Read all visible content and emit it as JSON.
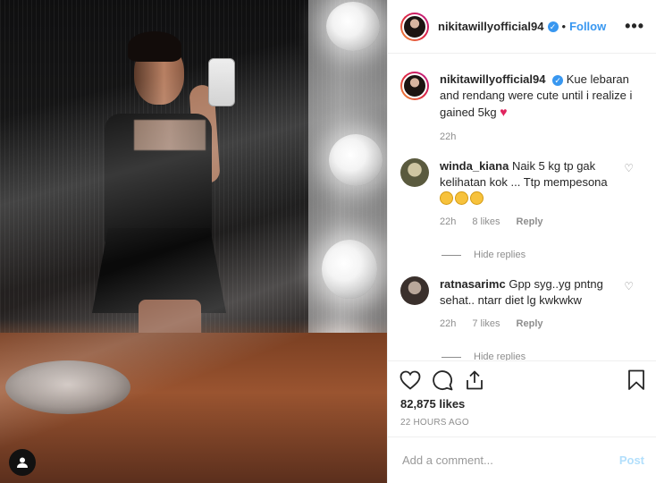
{
  "post_author": {
    "username": "nikitawillyofficial94",
    "verified": true,
    "separator": "•",
    "follow_label": "Follow",
    "more_label": "•••"
  },
  "caption": {
    "username": "nikitawillyofficial94",
    "text": "Kue lebaran and rendang were cute until i realize i gained 5kg",
    "emoji": "♥",
    "time": "22h"
  },
  "comments": [
    {
      "username": "winda_kiana",
      "text": "Naik 5 kg tp gak kelihatan kok ... Ttp mempesona",
      "emoji_count": 3,
      "time": "22h",
      "likes": "8 likes",
      "reply_label": "Reply",
      "hide_label": "Hide replies"
    },
    {
      "username": "ratnasarimc",
      "text": "Gpp syg..yg pntng sehat.. ntarr diet lg kwkwkw",
      "time": "22h",
      "likes": "7 likes",
      "reply_label": "Reply",
      "hide_label": "Hide replies"
    }
  ],
  "actions": {
    "like_icon": "heart-icon",
    "comment_icon": "comment-icon",
    "share_icon": "share-icon",
    "save_icon": "bookmark-icon"
  },
  "likes_count": "82,875 likes",
  "posted_ago": "22 HOURS AGO",
  "add_comment": {
    "placeholder": "Add a comment...",
    "post_label": "Post"
  },
  "colors": {
    "accent": "#3897f0",
    "post_disabled": "#b2dffc",
    "muted": "#8e8e8e"
  }
}
